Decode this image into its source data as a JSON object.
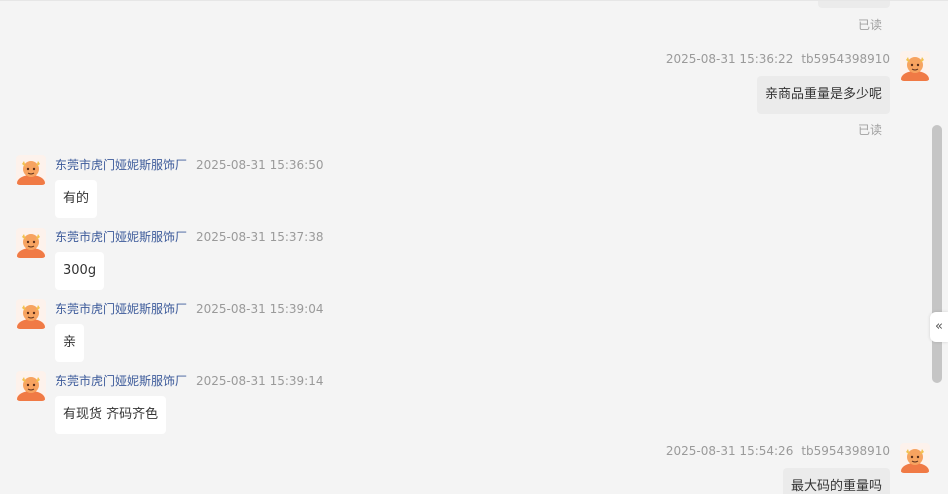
{
  "read_label": "已读",
  "seller": {
    "name": "东莞市虎门娅妮斯服饰厂"
  },
  "buyer": {
    "id": "tb5954398910"
  },
  "messages": [
    {
      "time": "2025-08-31 15:36:22",
      "text": "亲商品重量是多少呢"
    },
    {
      "time": "2025-08-31 15:36:50",
      "text": "有的"
    },
    {
      "time": "2025-08-31 15:37:38",
      "text": "300g"
    },
    {
      "time": "2025-08-31 15:39:04",
      "text": "亲"
    },
    {
      "time": "2025-08-31 15:39:14",
      "text": "有现货 齐码齐色"
    },
    {
      "time": "2025-08-31 15:54:26",
      "text": "最大码的重量吗"
    }
  ],
  "collapse_icon": "«",
  "colors": {
    "background": "#f4f4f4",
    "incoming_bubble": "#ffffff",
    "outgoing_bubble": "#ebebeb",
    "sender_name": "#3c5a9a",
    "avatar_orange": "#f07a45"
  }
}
